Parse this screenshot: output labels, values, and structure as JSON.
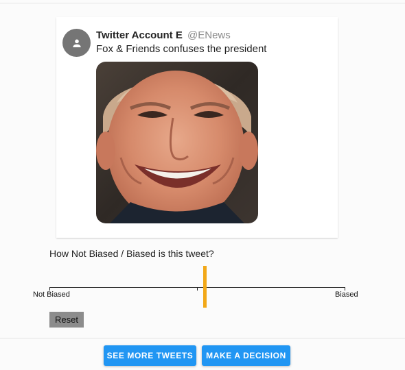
{
  "tweet": {
    "account_name": "Twitter Account E",
    "handle": "@ENews",
    "text": "Fox & Friends confuses the president",
    "avatar_icon": "person-icon",
    "image_alt": "Smiling man portrait"
  },
  "rating": {
    "question": "How Not Biased / Biased is this tweet?",
    "left_label": "Not Biased",
    "right_label": "Biased",
    "slider_value": 0.52,
    "accent_color": "#f2a818",
    "reset_label": "Reset"
  },
  "actions": {
    "see_more_label": "SEE MORE TWEETS",
    "decide_label": "MAKE A DECISION",
    "button_color": "#2196f3"
  }
}
